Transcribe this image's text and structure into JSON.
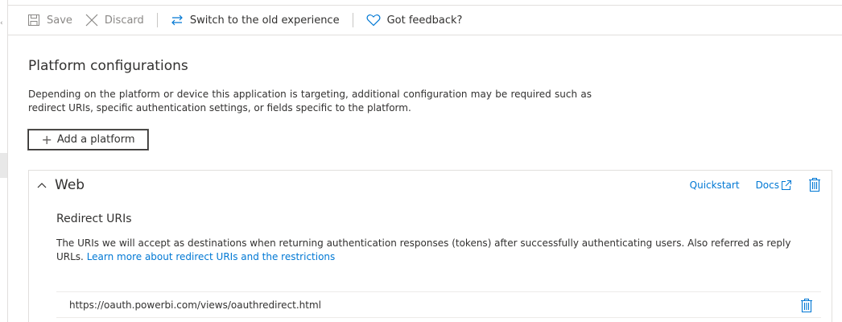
{
  "toolbar": {
    "save_label": "Save",
    "discard_label": "Discard",
    "switch_label": "Switch to the old experience",
    "feedback_label": "Got feedback?"
  },
  "page": {
    "title": "Platform configurations",
    "description": "Depending on the platform or device this application is targeting, additional configuration may be required such as redirect URIs, specific authentication settings, or fields specific to the platform.",
    "add_platform_label": "Add a platform"
  },
  "web_card": {
    "name": "Web",
    "quickstart_label": "Quickstart",
    "docs_label": "Docs",
    "redirect_title": "Redirect URIs",
    "redirect_desc": "The URIs we will accept as destinations when returning authentication responses (tokens) after successfully authenticating users. Also referred as reply URLs. ",
    "learn_more_label": "Learn more about redirect URIs and the restrictions",
    "redirect_uris": [
      "https://oauth.powerbi.com/views/oauthredirect.html"
    ]
  },
  "icons": {
    "save": "save-icon",
    "discard": "close-icon",
    "switch": "switch-arrows-icon",
    "feedback": "heart-icon",
    "add": "plus-icon",
    "collapse": "chevron-up-icon",
    "docs_external": "external-link-icon",
    "delete": "trash-icon"
  },
  "colors": {
    "accent": "#0078d4",
    "text": "#323130",
    "muted": "#8a8886",
    "border": "#e1dfdd"
  }
}
